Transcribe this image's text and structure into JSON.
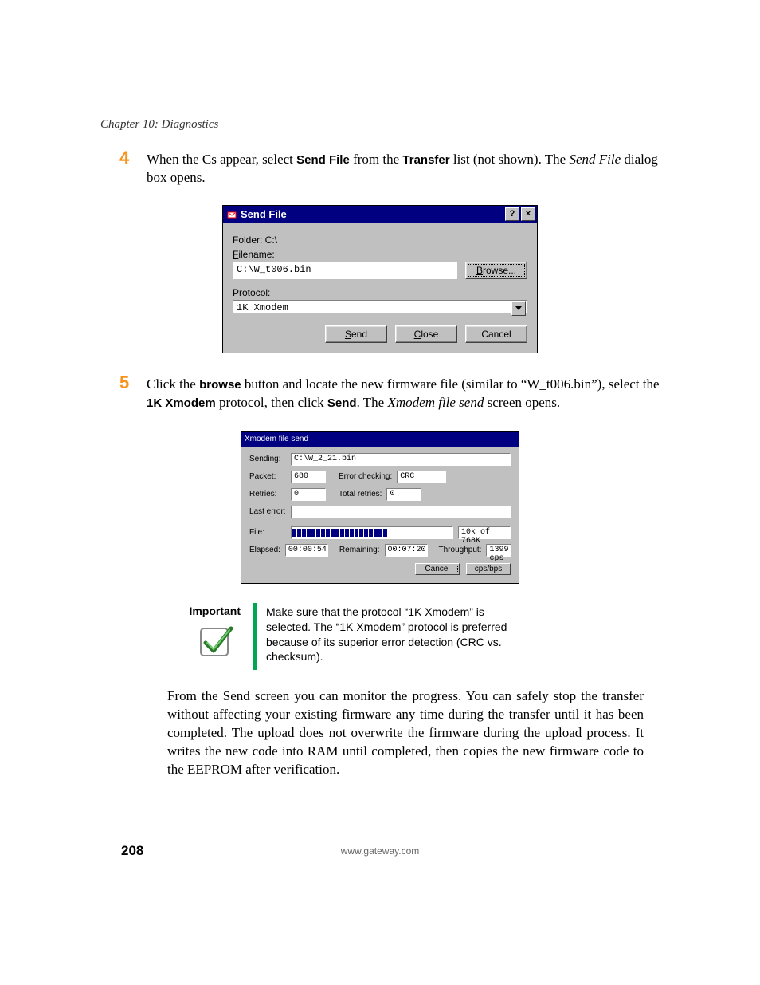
{
  "chapter": "Chapter 10: Diagnostics",
  "step4": {
    "num": "4",
    "text_pre": "When the Cs appear, select ",
    "b1": "Send File",
    "text_mid1": " from the ",
    "b2": "Transfer",
    "text_mid2": " list (not shown). The ",
    "i1": "Send File",
    "text_post": " dialog box opens."
  },
  "dialog1": {
    "title": "Send File",
    "folder_label": "Folder: C:\\",
    "filename_label_u": "F",
    "filename_label_rest": "ilename:",
    "filename_value": "C:\\W_t006.bin",
    "browse_u": "B",
    "browse_rest": "rowse...",
    "protocol_label_u": "P",
    "protocol_label_rest": "rotocol:",
    "protocol_value": "1K Xmodem",
    "send_u": "S",
    "send_rest": "end",
    "close_u": "C",
    "close_rest": "lose",
    "cancel": "Cancel"
  },
  "step5": {
    "num": "5",
    "text_pre": "Click the ",
    "b1": "browse",
    "text_mid1": " button and locate the new firmware file (similar to “W_t006.bin”), select the ",
    "b2": "1K Xmodem",
    "text_mid2": " protocol, then click ",
    "b3": "Send",
    "text_mid3": ". The ",
    "i1": "Xmodem file send",
    "text_post": " screen opens."
  },
  "dialog2": {
    "title": "Xmodem file send",
    "sending_label": "Sending:",
    "sending_value": "C:\\W_2_21.bin",
    "packet_label": "Packet:",
    "packet_value": "680",
    "errchk_label": "Error checking:",
    "errchk_value": "CRC",
    "retries_label": "Retries:",
    "retries_value": "0",
    "totalretries_label": "Total retries:",
    "totalretries_value": "0",
    "lasterror_label": "Last error:",
    "lasterror_value": "",
    "file_label": "File:",
    "file_status": "10k of 768K",
    "elapsed_label": "Elapsed:",
    "elapsed_value": "00:00:54",
    "remaining_label": "Remaining:",
    "remaining_value": "00:07:20",
    "throughput_label": "Throughput:",
    "throughput_value": "1399 cps",
    "cancel": "Cancel",
    "cpsbps": "cps/bps"
  },
  "important": {
    "label": "Important",
    "text": "Make sure that the protocol “1K Xmodem” is selected. The “1K Xmodem” protocol is preferred because of its superior error detection (CRC vs. checksum)."
  },
  "body_para": "From the Send screen you can monitor the progress. You can safely stop the transfer without affecting your existing firmware any time during the transfer until it has been completed. The upload does not overwrite the firmware during the upload process. It writes the new code into RAM until completed, then copies the new firmware code to the EEPROM after verification.",
  "footer": {
    "page": "208",
    "url": "www.gateway.com"
  }
}
